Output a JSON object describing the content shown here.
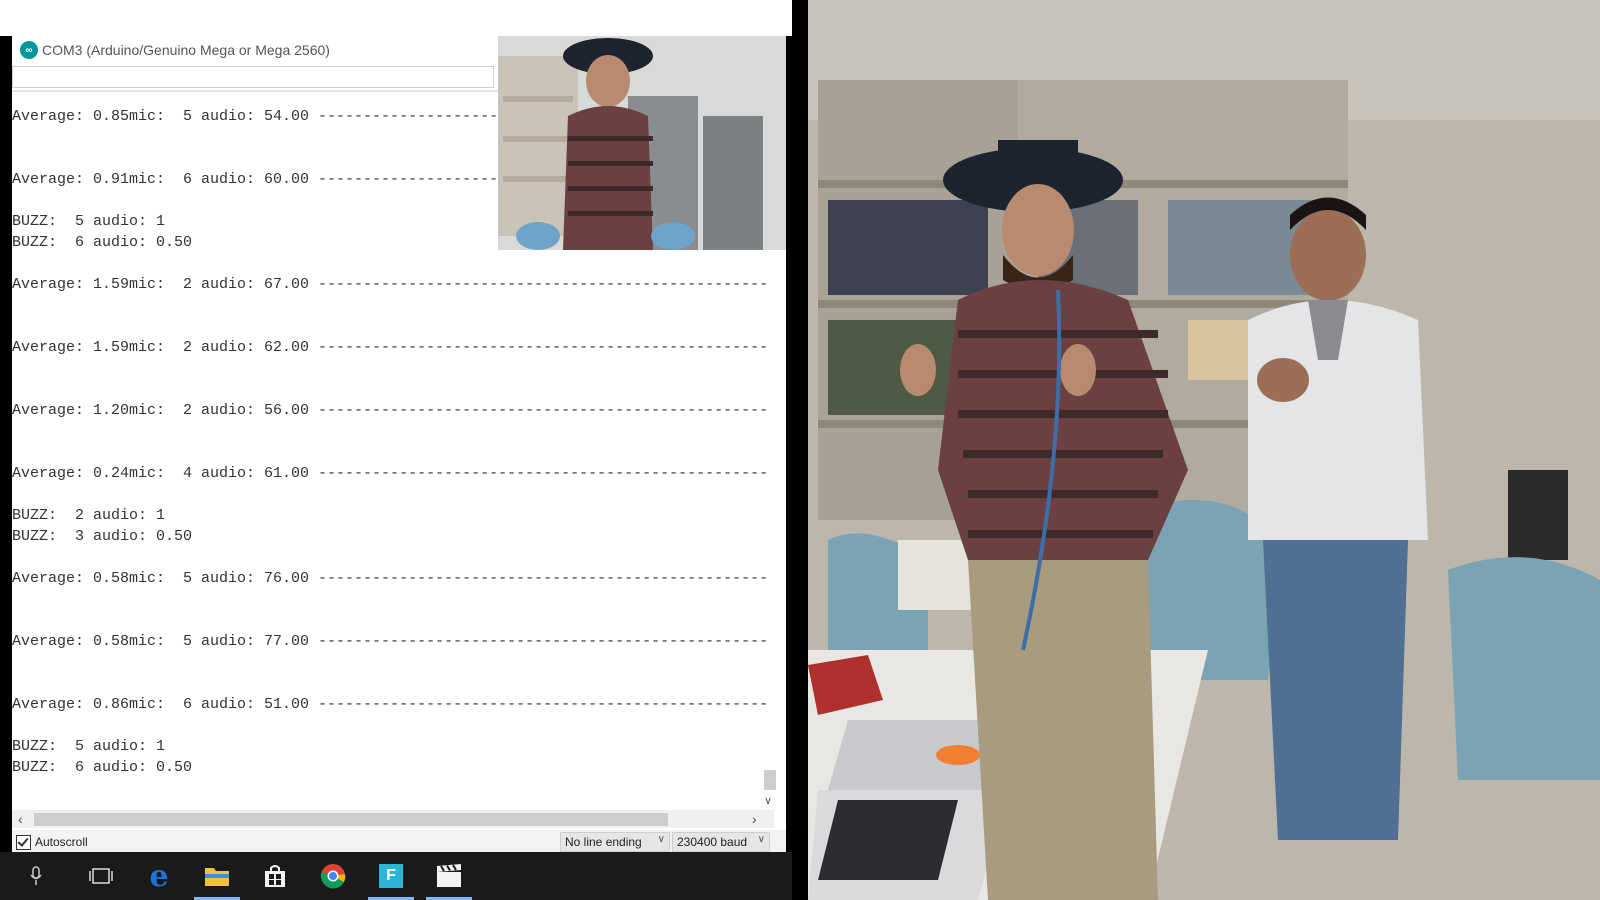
{
  "window": {
    "title": "COM3 (Arduino/Genuino Mega or Mega 2560)",
    "send_input_value": ""
  },
  "serial_output": {
    "lines": [
      "Average: 0.85mic:  5 audio: 54.00 --------------------------------------------------",
      "Average: 0.91mic:  6 audio: 60.00 --------------------------------------------------",
      "BUZZ:  5 audio: 1",
      "BUZZ:  6 audio: 0.50",
      "Average: 1.59mic:  2 audio: 67.00 --------------------------------------------------",
      "Average: 1.59mic:  2 audio: 62.00 --------------------------------------------------",
      "Average: 1.20mic:  2 audio: 56.00 --------------------------------------------------",
      "Average: 0.24mic:  4 audio: 61.00 --------------------------------------------------",
      "BUZZ:  2 audio: 1",
      "BUZZ:  3 audio: 0.50",
      "Average: 0.58mic:  5 audio: 76.00 --------------------------------------------------",
      "Average: 0.58mic:  5 audio: 77.00 --------------------------------------------------",
      "Average: 0.86mic:  6 audio: 51.00 --------------------------------------------------",
      "BUZZ:  5 audio: 1",
      "BUZZ:  6 audio: 0.50"
    ]
  },
  "footer": {
    "autoscroll_label": "Autoscroll",
    "autoscroll_checked": true,
    "line_ending": "No line ending",
    "baud_rate": "230400 baud"
  },
  "taskbar": {
    "icons": [
      "microphone-icon",
      "task-view-icon",
      "edge-icon",
      "file-explorer-icon",
      "store-icon",
      "chrome-icon",
      "f-app-icon",
      "video-editor-icon"
    ]
  },
  "colors": {
    "arduino_teal": "#00979c",
    "taskbar": "#1a1a1a",
    "edge_blue": "#1e73d8",
    "folder_yellow": "#f0c040"
  }
}
